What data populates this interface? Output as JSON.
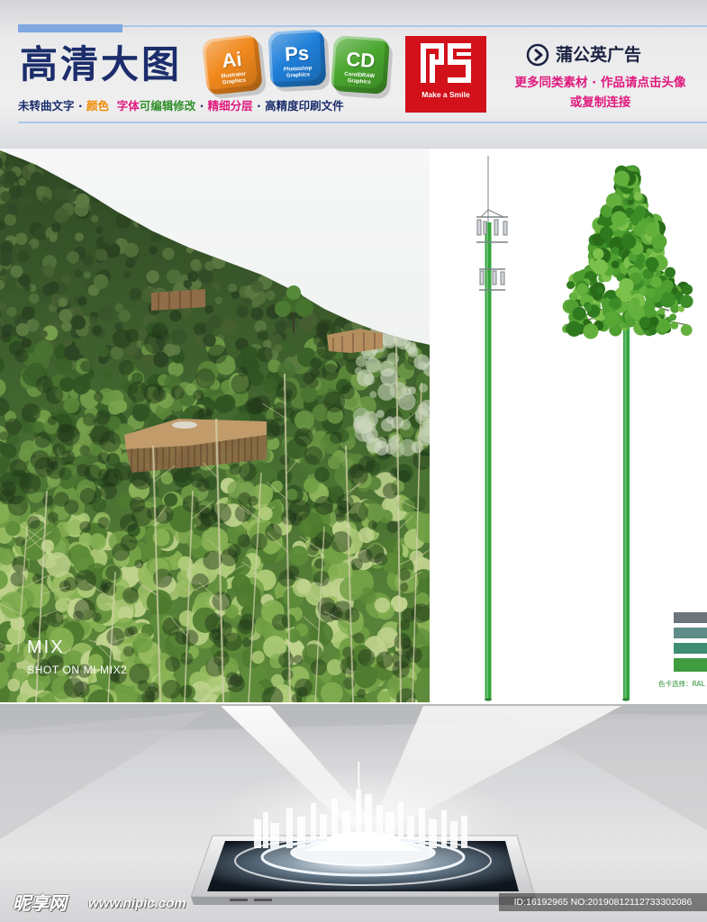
{
  "header": {
    "title": "高清大图",
    "title_color": "#1b2d6b",
    "features": [
      {
        "text": "未转曲文字",
        "color": "#1b2d6b"
      },
      {
        "text": " · ",
        "color": "#1b2d6b"
      },
      {
        "text": "颜色",
        "color": "#f08a00"
      },
      {
        "text": "  字体",
        "color": "#e0197d"
      },
      {
        "text": "可编辑修改",
        "color": "#2f8f2a"
      },
      {
        "text": " · ",
        "color": "#1b2d6b"
      },
      {
        "text": "精细分层",
        "color": "#e0197d"
      },
      {
        "text": " · ",
        "color": "#1b2d6b"
      },
      {
        "text": "高精度印刷文件",
        "color": "#1b2d6b"
      }
    ],
    "software_icons": [
      {
        "label": "Ai",
        "name": "Illustrator",
        "sub": "Graphics",
        "color": "#f1891d",
        "icon": "illustrator-icon"
      },
      {
        "label": "Ps",
        "name": "Photoshop",
        "sub": "Graphics",
        "color": "#1f7fd8",
        "icon": "photoshop-icon"
      },
      {
        "label": "CD",
        "name": "CorelDRAW",
        "sub": "Graphics",
        "color": "#49a62e",
        "icon": "coreldraw-icon"
      }
    ],
    "logo": {
      "caption": "Make a Smile",
      "color": "#d2111b",
      "icon": "monogram-logo"
    },
    "brand": {
      "name": "蒲公英广告",
      "color": "#1a2240",
      "icon": "circle-arrow-right-icon"
    },
    "promo": {
      "line1": "更多同类素材 · 作品请点击头像",
      "line2": "或复制连接",
      "color": "#e0197d"
    }
  },
  "photo": {
    "watermark_title": "MIX",
    "watermark_caption": "SHOT ON MI MIX2"
  },
  "product_panel": {
    "pole_color": "#33a43d",
    "swatches": [
      "#6d757c",
      "#5e8c88",
      "#3f8e74",
      "#3f9d3f"
    ],
    "swatch_label": "色卡选择：RAL"
  },
  "footer": {
    "site_name": "昵享网",
    "site_url": "www.nipic.com",
    "image_id": "ID:16192965 NO:20190812112733302086"
  }
}
